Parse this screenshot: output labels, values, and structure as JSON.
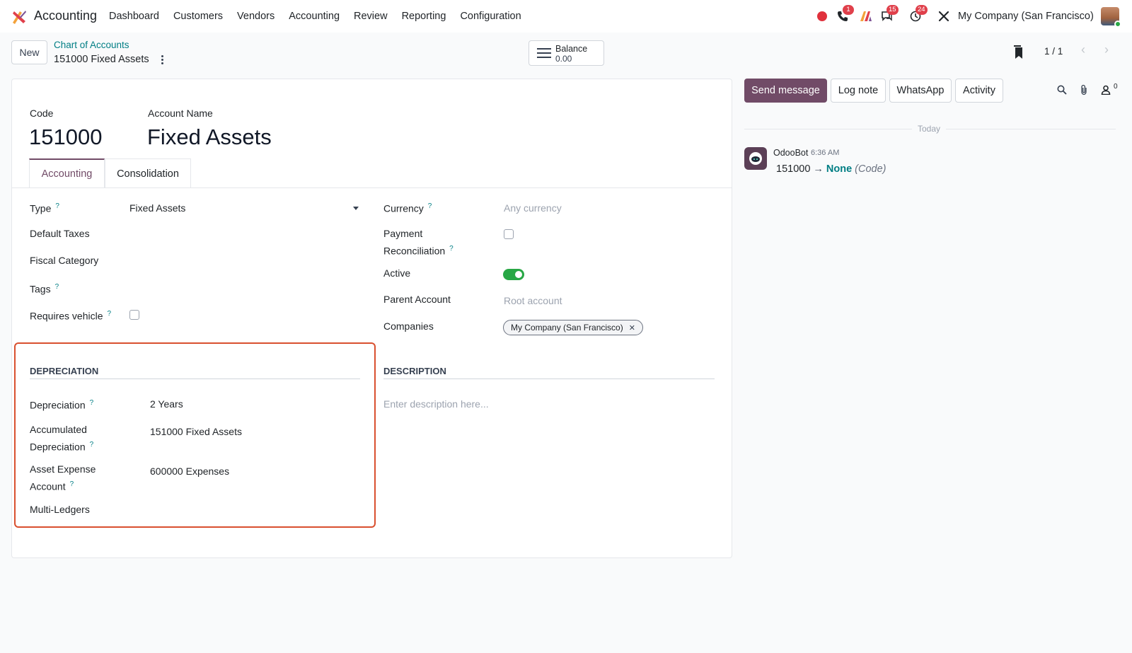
{
  "navbar": {
    "app_name": "Accounting",
    "menu": [
      "Dashboard",
      "Customers",
      "Vendors",
      "Accounting",
      "Review",
      "Reporting",
      "Configuration"
    ],
    "badges": {
      "phone": "1",
      "messages": "15",
      "activities": "24"
    },
    "company": "My Company (San Francisco)"
  },
  "control": {
    "new_label": "New",
    "breadcrumb": "Chart of Accounts",
    "record_title": "151000 Fixed Assets",
    "balance_label": "Balance",
    "balance_value": "0.00",
    "pager": "1 / 1"
  },
  "form": {
    "code_label": "Code",
    "code_value": "151000",
    "name_label": "Account Name",
    "name_value": "Fixed Assets",
    "tabs": [
      "Accounting",
      "Consolidation"
    ],
    "left": {
      "type_label": "Type",
      "type_value": "Fixed Assets",
      "default_taxes_label": "Default Taxes",
      "fiscal_category_label": "Fiscal Category",
      "tags_label": "Tags",
      "requires_vehicle_label": "Requires vehicle"
    },
    "right": {
      "currency_label": "Currency",
      "currency_placeholder": "Any currency",
      "payment_label_1": "Payment",
      "payment_label_2": "Reconciliation",
      "active_label": "Active",
      "parent_label": "Parent Account",
      "parent_placeholder": "Root account",
      "companies_label": "Companies",
      "company_tag": "My Company (San Francisco)"
    },
    "depreciation": {
      "title": "DEPRECIATION",
      "depreciation_label": "Depreciation",
      "depreciation_value": "2 Years",
      "accum_label_1": "Accumulated",
      "accum_label_2": "Depreciation",
      "accum_value": "151000 Fixed Assets",
      "expense_label_1": "Asset Expense",
      "expense_label_2": "Account",
      "expense_value": "600000 Expenses",
      "multi_ledgers_label": "Multi-Ledgers"
    },
    "description": {
      "title": "DESCRIPTION",
      "placeholder": "Enter description here..."
    }
  },
  "chatter": {
    "send_message": "Send message",
    "log_note": "Log note",
    "whatsapp": "WhatsApp",
    "activity": "Activity",
    "followers_count": "0",
    "today": "Today",
    "author": "OdooBot",
    "time": "6:36 AM",
    "old_value": "151000",
    "arrow": "→",
    "new_value": "None",
    "field_name": "(Code)"
  },
  "colors": {
    "brand": "#714b67",
    "link": "#017e84",
    "highlight": "#d9502f",
    "toggle_on": "#28a745"
  }
}
